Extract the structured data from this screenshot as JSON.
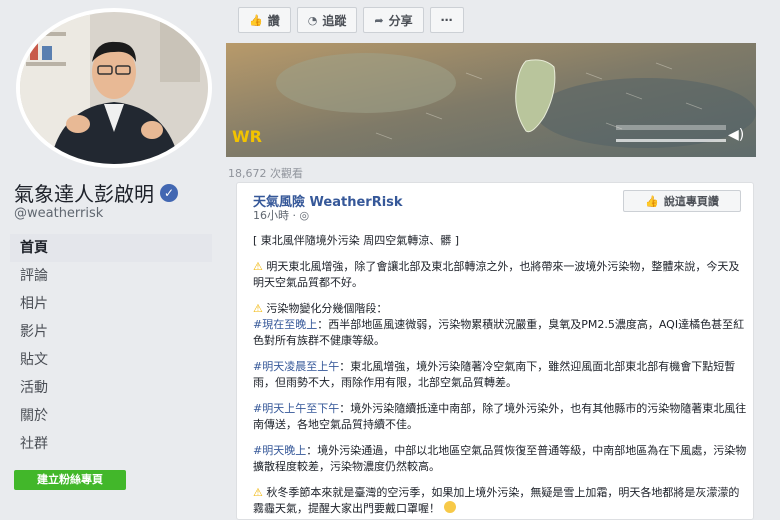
{
  "profile": {
    "name": "氣象達人彭啟明",
    "username": "@weatherrisk",
    "verified_icon": "check-icon"
  },
  "nav": {
    "items": [
      "首頁",
      "評論",
      "相片",
      "影片",
      "貼文",
      "活動",
      "關於",
      "社群"
    ],
    "active": "首頁"
  },
  "create_button": "建立粉絲專頁",
  "actions": [
    {
      "label": "讚",
      "icon": "thumbs-up-icon"
    },
    {
      "label": "追蹤",
      "icon": "rss-icon"
    },
    {
      "label": "分享",
      "icon": "share-icon"
    },
    {
      "label": "⋯",
      "icon": "more-icon"
    }
  ],
  "video": {
    "views": "18,672 次觀看",
    "logo_text": "WR"
  },
  "post": {
    "author": "天氣風險 WeatherRisk",
    "time": "16小時 · ",
    "like_page_label": "說這專頁讚",
    "para1": "[ 東北風伴隨境外污染 周四空氣轉涼、髒 ]",
    "para2_text": "明天東北風增強，除了會讓北部及東北部轉涼之外，也將帶來一波境外污染物，整體來說，今天及明天空氣品質都不好。",
    "para3_intro": "污染物變化分幾個階段：",
    "para3_tag": "#現在至晚上",
    "para3_text": "：西半部地區風速微弱，污染物累積狀況嚴重，臭氧及PM2.5濃度高，AQI達橘色甚至紅色對所有族群不健康等級。",
    "para4_tag": "#明天凌晨至上午",
    "para4_text": "：東北風增強，境外污染隨著冷空氣南下，雖然迎風面北部東北部有機會下點短暫雨，但雨勢不大，雨除作用有限，北部空氣品質轉差。",
    "para5_tag": "#明天上午至下午",
    "para5_text": "：境外污染隨續抵達中南部，除了境外污染外，也有其他縣市的污染物隨著東北風往南傳送，各地空氣品質持續不佳。",
    "para6_tag": "#明天晚上",
    "para6_text": "：境外污染通過，中部以北地區空氣品質恢復至普通等級，中南部地區為在下風處，污染物擴散程度較差，污染物濃度仍然較高。",
    "para7_text": "秋冬季節本來就是臺灣的空污季，如果加上境外污染，無疑是雪上加霜，明天各地都將是灰濛濛的霧霾天氣，提醒大家出門要戴口罩喔！"
  }
}
